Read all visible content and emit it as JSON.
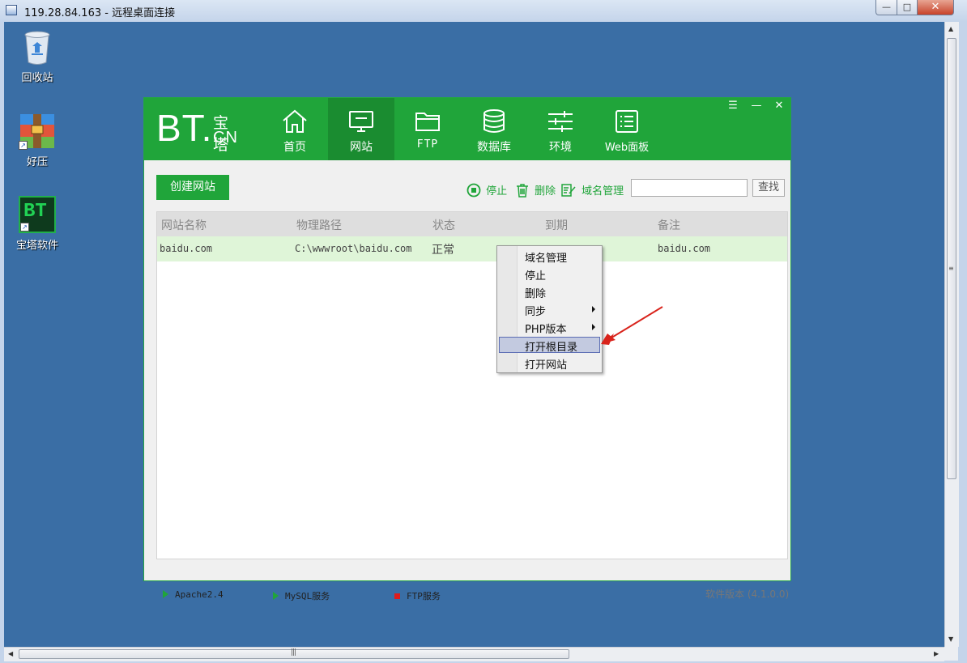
{
  "window": {
    "title": "119.28.84.163 - 远程桌面连接",
    "minimize_label": "—",
    "maximize_label": "□",
    "close_label": "✕"
  },
  "desktop": {
    "icons": [
      {
        "label": "回收站",
        "icon": "recycle-bin-icon"
      },
      {
        "label": "好压",
        "icon": "haozip-icon"
      },
      {
        "label": "宝塔软件",
        "icon": "bt-panel-icon",
        "glyph": "BT"
      }
    ]
  },
  "bt": {
    "logo": {
      "bt": "BT.",
      "bao": "宝塔",
      "cn": "CN"
    },
    "nav": [
      {
        "label": "首页",
        "icon": "home-icon"
      },
      {
        "label": "网站",
        "icon": "monitor-icon",
        "active": true
      },
      {
        "label": "FTP",
        "icon": "folder-icon"
      },
      {
        "label": "数据库",
        "icon": "database-icon"
      },
      {
        "label": "环境",
        "icon": "sliders-icon"
      },
      {
        "label": "Web面板",
        "icon": "list-panel-icon"
      }
    ],
    "controls": {
      "menu": "☰",
      "min": "—",
      "close": "✕"
    },
    "toolbar": {
      "create_label": "创建网站",
      "stop_label": "停止",
      "delete_label": "删除",
      "domain_label": "域名管理",
      "search_value": "",
      "search_label": "查找"
    },
    "table": {
      "headers": [
        "网站名称",
        "物理路径",
        "状态",
        "到期",
        "备注"
      ],
      "rows": [
        {
          "name": "baidu.com",
          "path": "C:\\wwwroot\\baidu.com",
          "status": "正常",
          "expire": "",
          "note": "baidu.com"
        }
      ]
    },
    "context_menu": [
      {
        "label": "域名管理"
      },
      {
        "label": "停止"
      },
      {
        "label": "删除"
      },
      {
        "label": "同步",
        "submenu": true
      },
      {
        "label": "PHP版本",
        "submenu": true
      },
      {
        "label": "打开根目录",
        "highlighted": true
      },
      {
        "label": "打开网站"
      }
    ],
    "statusbar": {
      "services": [
        {
          "label": "Apache2.4",
          "state": "running"
        },
        {
          "label": "MySQL服务",
          "state": "running"
        },
        {
          "label": "FTP服务",
          "state": "stopped"
        }
      ],
      "version": "软件版本 (4.1.0.0)"
    },
    "colors": {
      "brand": "#20a53a",
      "active_nav": "#1a8c30",
      "row_selected": "#dff5d8",
      "desktop": "#3a6ea5",
      "stopped": "#e01b1b",
      "arrow": "#d9241c"
    }
  }
}
